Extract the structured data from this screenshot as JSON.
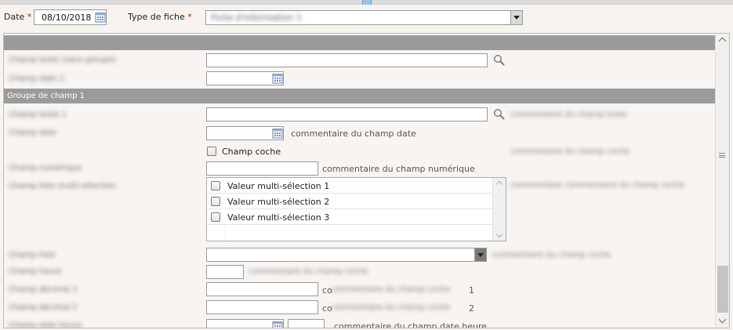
{
  "header": {
    "date_label": "Date",
    "required_mark": "*",
    "date_value": "08/10/2018",
    "type_label": "Type de fiche",
    "type_value": "Fiche d'information 1"
  },
  "form": {
    "section_top_title": "",
    "fields_top": [
      {
        "label": "Champ texte (sans groupe)"
      },
      {
        "label": "Champ date 2"
      }
    ],
    "group1_title": "Groupe de champ 1",
    "fields_group": {
      "text1": {
        "label": "Champ texte 1",
        "comment": "commentaire du champ texte"
      },
      "date": {
        "label": "Champ date",
        "comment": "commentaire du champ date"
      },
      "checkbox": {
        "label": "Champ coche",
        "comment": "commentaire du champ coche"
      },
      "numeric": {
        "label": "Champ numérique",
        "comment": "commentaire du champ numérique"
      },
      "multi": {
        "label": "Champ liste multi-sélection",
        "comment": "commentaire commentaire du champ coche",
        "options": [
          "Valeur multi-sélection 1",
          "Valeur multi-sélection 2",
          "Valeur multi-sélection 3"
        ]
      },
      "list": {
        "label": "Champ liste",
        "comment": "commentaire du champ coche"
      },
      "hour": {
        "label": "Champ heure",
        "comment": "commentaire du champ coche"
      },
      "decimal1": {
        "label": "Champ décimal 1",
        "comment_prefix": "co",
        "comment": "commentaire du champ coche",
        "suffix": "1"
      },
      "decimal2": {
        "label": "Champ décimal 2",
        "comment_prefix": "co",
        "comment": "commentaire du champ coche",
        "suffix": "2"
      },
      "datetime": {
        "label": "Champ date heure",
        "comment": "commentaire du champ date heure"
      }
    }
  },
  "icons": {
    "calendar": "calendar-icon",
    "search": "search-icon",
    "dropdown": "chevron-down-icon"
  },
  "colors": {
    "required": "#c0161b",
    "band": "#9b9b9b",
    "background": "#f7f3ef"
  }
}
